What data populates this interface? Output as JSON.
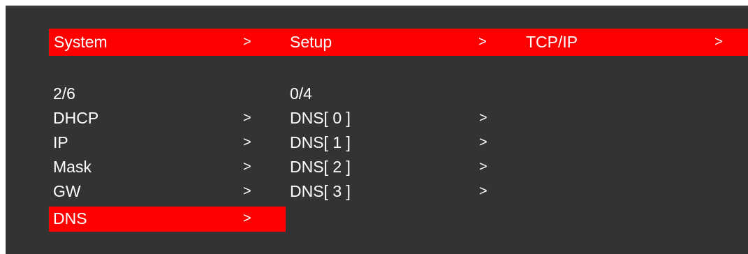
{
  "header": {
    "breadcrumb": [
      {
        "label": "System",
        "arrow": ">"
      },
      {
        "label": "Setup",
        "arrow": ">"
      },
      {
        "label": "TCP/IP",
        "arrow": ">"
      }
    ]
  },
  "left_menu": {
    "counter": "2/6",
    "items": [
      {
        "label": "DHCP",
        "arrow": ">"
      },
      {
        "label": "IP",
        "arrow": ">"
      },
      {
        "label": "Mask",
        "arrow": ">"
      },
      {
        "label": "GW",
        "arrow": ">"
      },
      {
        "label": "DNS",
        "arrow": ">",
        "selected": true
      }
    ]
  },
  "right_menu": {
    "counter": "0/4",
    "items": [
      {
        "label": "DNS[ 0 ]",
        "arrow": ">"
      },
      {
        "label": "DNS[ 1 ]",
        "arrow": ">"
      },
      {
        "label": "DNS[ 2 ]",
        "arrow": ">"
      },
      {
        "label": "DNS[ 3 ]",
        "arrow": ">"
      }
    ]
  },
  "colors": {
    "background": "#333333",
    "highlight": "#ff0000",
    "text": "#ffffff"
  }
}
